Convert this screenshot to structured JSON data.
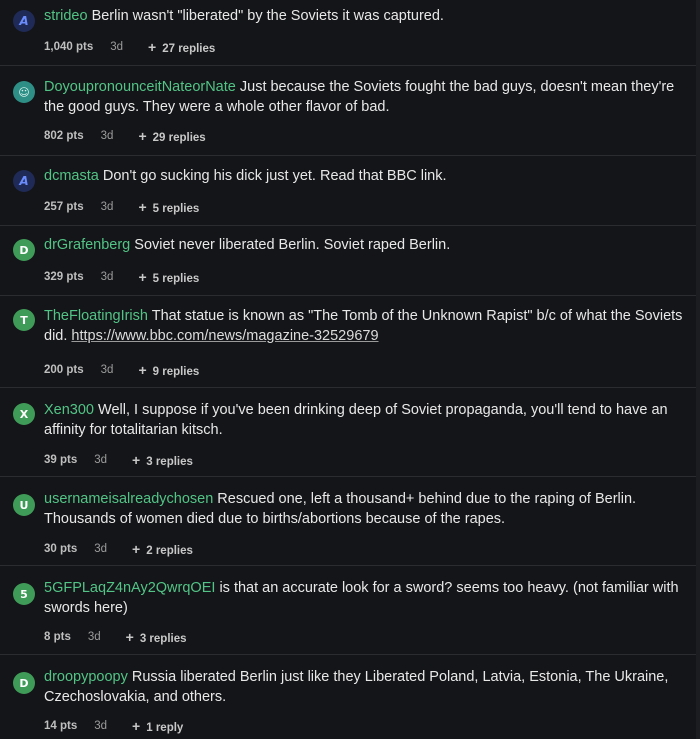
{
  "comments": [
    {
      "avatar": "A",
      "user": "strideo",
      "text": "Berlin wasn't \"liberated\" by the Soviets it was captured.",
      "points": "1,040 pts",
      "age": "3d",
      "replies": "27 replies"
    },
    {
      "avatar": "☺",
      "user": "DoyoupronounceitNateorNate",
      "text": "Just because the Soviets fought the bad guys, doesn't mean they're the good guys. They were a whole other flavor of bad.",
      "points": "802 pts",
      "age": "3d",
      "replies": "29 replies"
    },
    {
      "avatar": "A",
      "user": "dcmasta",
      "text": "Don't go sucking his dick just yet. Read that BBC link.",
      "points": "257 pts",
      "age": "3d",
      "replies": "5 replies"
    },
    {
      "avatar": "D",
      "user": "drGrafenberg",
      "text": "Soviet never liberated Berlin. Soviet raped Berlin.",
      "points": "329 pts",
      "age": "3d",
      "replies": "5 replies"
    },
    {
      "avatar": "T",
      "user": "TheFloatingIrish",
      "text": "That statue is known as \"The Tomb of the Unknown Rapist\" b/c of what the Soviets did.",
      "link": "https://www.bbc.com/news/magazine-32529679",
      "points": "200 pts",
      "age": "3d",
      "replies": "9 replies"
    },
    {
      "avatar": "X",
      "user": "Xen300",
      "text": "Well, I suppose if you've been drinking deep of Soviet propaganda, you'll tend to have an affinity for totalitarian kitsch.",
      "points": "39 pts",
      "age": "3d",
      "replies": "3 replies"
    },
    {
      "avatar": "U",
      "user": "usernameisalreadychosen",
      "text": "Rescued one, left a thousand+ behind due to the raping of Berlin. Thousands of women died due to births/abortions because of the rapes.",
      "points": "30 pts",
      "age": "3d",
      "replies": "2 replies"
    },
    {
      "avatar": "5",
      "user": "5GFPLaqZ4nAy2QwrqOEI",
      "text": "is that an accurate look for a sword? seems too heavy. (not familiar with swords here)",
      "points": "8 pts",
      "age": "3d",
      "replies": "3 replies"
    },
    {
      "avatar": "D",
      "user": "droopypoopy",
      "text": "Russia liberated Berlin just like they Liberated Poland, Latvia, Estonia, The Ukraine, Czechoslovakia, and others.",
      "points": "14 pts",
      "age": "3d",
      "replies": "1 reply"
    }
  ]
}
